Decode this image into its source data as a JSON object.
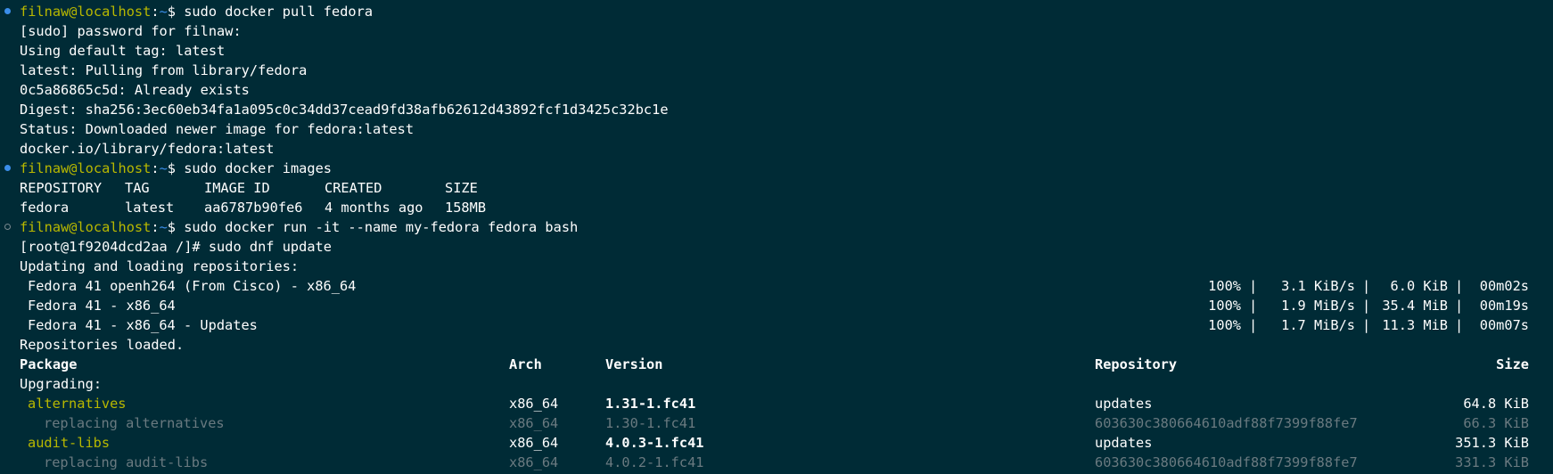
{
  "terminal": {
    "prompt_user_host": "filnaw@localhost",
    "prompt_colon": ":",
    "prompt_tilde": "~",
    "prompt_dollar": "$ ",
    "blocks": {
      "pull": {
        "command": "sudo docker pull fedora",
        "output": [
          "[sudo] password for filnaw:",
          "Using default tag: latest",
          "latest: Pulling from library/fedora",
          "0c5a86865c5d: Already exists",
          "Digest: sha256:3ec60eb34fa1a095c0c34dd37cead9fd38afb62612d43892fcf1d3425c32bc1e",
          "Status: Downloaded newer image for fedora:latest",
          "docker.io/library/fedora:latest"
        ]
      },
      "images": {
        "command": "sudo docker images",
        "header": [
          "REPOSITORY",
          "TAG",
          "IMAGE ID",
          "CREATED",
          "SIZE"
        ],
        "row": [
          "fedora",
          "latest",
          "aa6787b90fe6",
          "4 months ago",
          "158MB"
        ]
      },
      "run": {
        "command": "sudo docker run -it --name my-fedora fedora bash",
        "root_prompt": "[root@1f9204dcd2aa /]# ",
        "root_command": "sudo dnf update",
        "updating": "Updating and loading repositories:",
        "repos": [
          {
            "name": "Fedora 41 openh264 (From Cisco) - x86_64",
            "percent": "100%",
            "speed": "3.1 KiB/s",
            "size": "6.0 KiB",
            "time": "00m02s"
          },
          {
            "name": "Fedora 41 - x86_64",
            "percent": "100%",
            "speed": "1.9 MiB/s",
            "size": "35.4 MiB",
            "time": "00m19s"
          },
          {
            "name": "Fedora 41 - x86_64 - Updates",
            "percent": "100%",
            "speed": "1.7 MiB/s",
            "size": "11.3 MiB",
            "time": "00m07s"
          }
        ],
        "loaded": "Repositories loaded.",
        "separator": "|",
        "pkg_header": {
          "package": "Package",
          "arch": "Arch",
          "version": "Version",
          "repository": "Repository",
          "size": "Size"
        },
        "upgrading": "Upgrading:",
        "packages": [
          {
            "name": "alternatives",
            "arch": "x86_64",
            "version": "1.31-1.fc41",
            "repository": "updates",
            "size": "64.8 KiB",
            "replacing": {
              "label": "replacing alternatives",
              "arch": "x86_64",
              "version": "1.30-1.fc41",
              "repository": "603630c380664610adf88f7399f88fe7",
              "size": "66.3 KiB"
            }
          },
          {
            "name": "audit-libs",
            "arch": "x86_64",
            "version": "4.0.3-1.fc41",
            "repository": "updates",
            "size": "351.3 KiB",
            "replacing": {
              "label": "replacing audit-libs",
              "arch": "x86_64",
              "version": "4.0.2-1.fc41",
              "repository": "603630c380664610adf88f7399f88fe7",
              "size": "331.3 KiB"
            }
          }
        ]
      }
    },
    "colors": {
      "background": "#002b36",
      "prompt_green": "#b8b800",
      "tilde_blue": "#3b8eea",
      "text": "#ffffff",
      "muted": "#6a7a80"
    }
  }
}
